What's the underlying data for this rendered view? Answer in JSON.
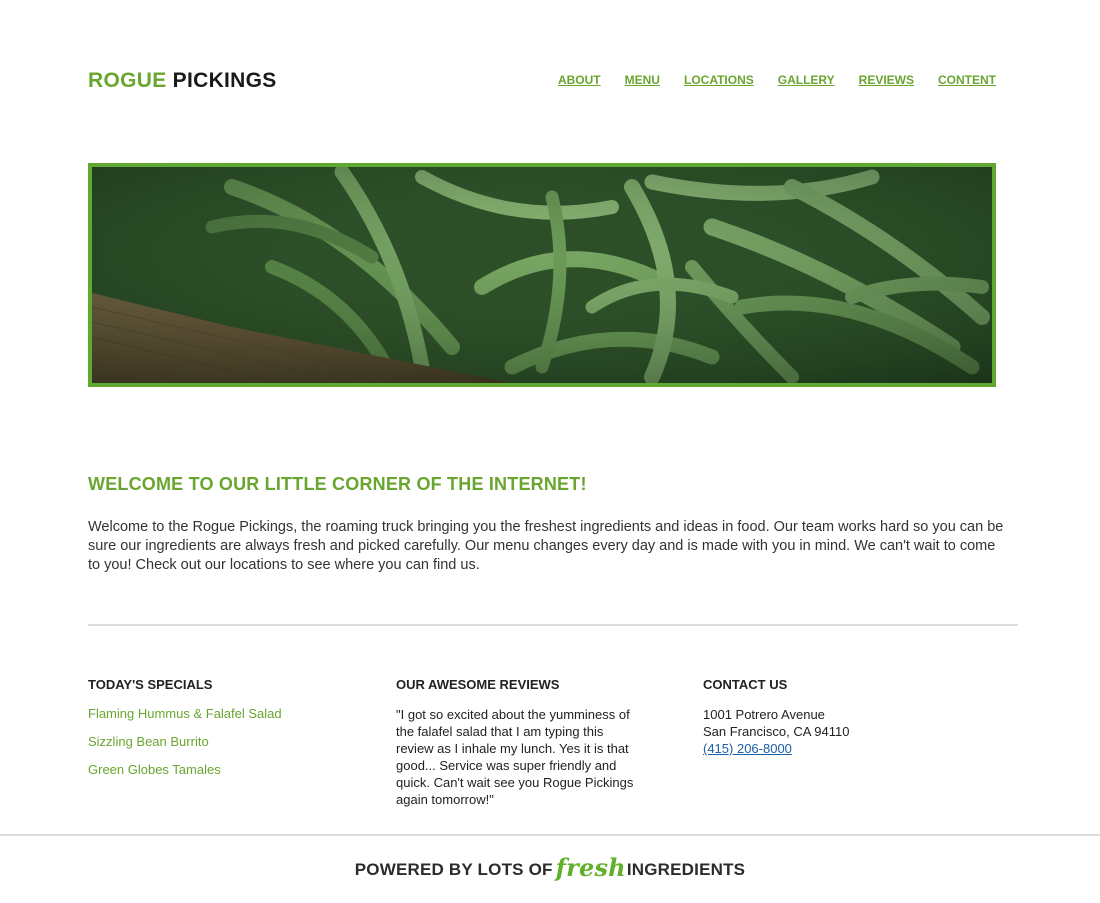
{
  "brand": {
    "part1": "ROGUE",
    "part2": "PICKINGS"
  },
  "nav": [
    {
      "label": "ABOUT"
    },
    {
      "label": "MENU"
    },
    {
      "label": "LOCATIONS"
    },
    {
      "label": "GALLERY"
    },
    {
      "label": "REVIEWS"
    },
    {
      "label": "CONTENT"
    }
  ],
  "welcome": {
    "title": "WELCOME TO OUR LITTLE CORNER OF THE INTERNET!",
    "text": "Welcome to the Rogue Pickings, the roaming truck bringing you the freshest ingredients and ideas in food. Our team works hard so you can be sure our ingredients are always fresh and picked carefully. Our menu changes every day and is made with you in mind. We can't wait to come to you! Check out our locations to see where you can find us."
  },
  "specials": {
    "heading": "TODAY'S SPECIALS",
    "items": [
      {
        "label": "Flaming Hummus & Falafel Salad"
      },
      {
        "label": "Sizzling Bean Burrito"
      },
      {
        "label": "Green Globes Tamales"
      }
    ]
  },
  "reviews": {
    "heading": "OUR AWESOME REVIEWS",
    "quote": "\"I got so excited about the yumminess of the falafel salad that I am typing this review as I inhale my lunch. Yes it is that good... Service was super friendly and quick. Can't wait see you Rogue Pickings again tomorrow!\""
  },
  "contact": {
    "heading": "CONTACT US",
    "address1": "1001 Potrero Avenue",
    "address2": "San Francisco, CA 94110",
    "phone": "(415) 206-8000"
  },
  "footer": {
    "prefix": "POWERED BY LOTS OF",
    "fresh": "fresh",
    "suffix": "INGREDIENTS"
  },
  "colors": {
    "accent": "#69a52f",
    "frame": "#5fa832",
    "link": "#1a5fa8"
  }
}
